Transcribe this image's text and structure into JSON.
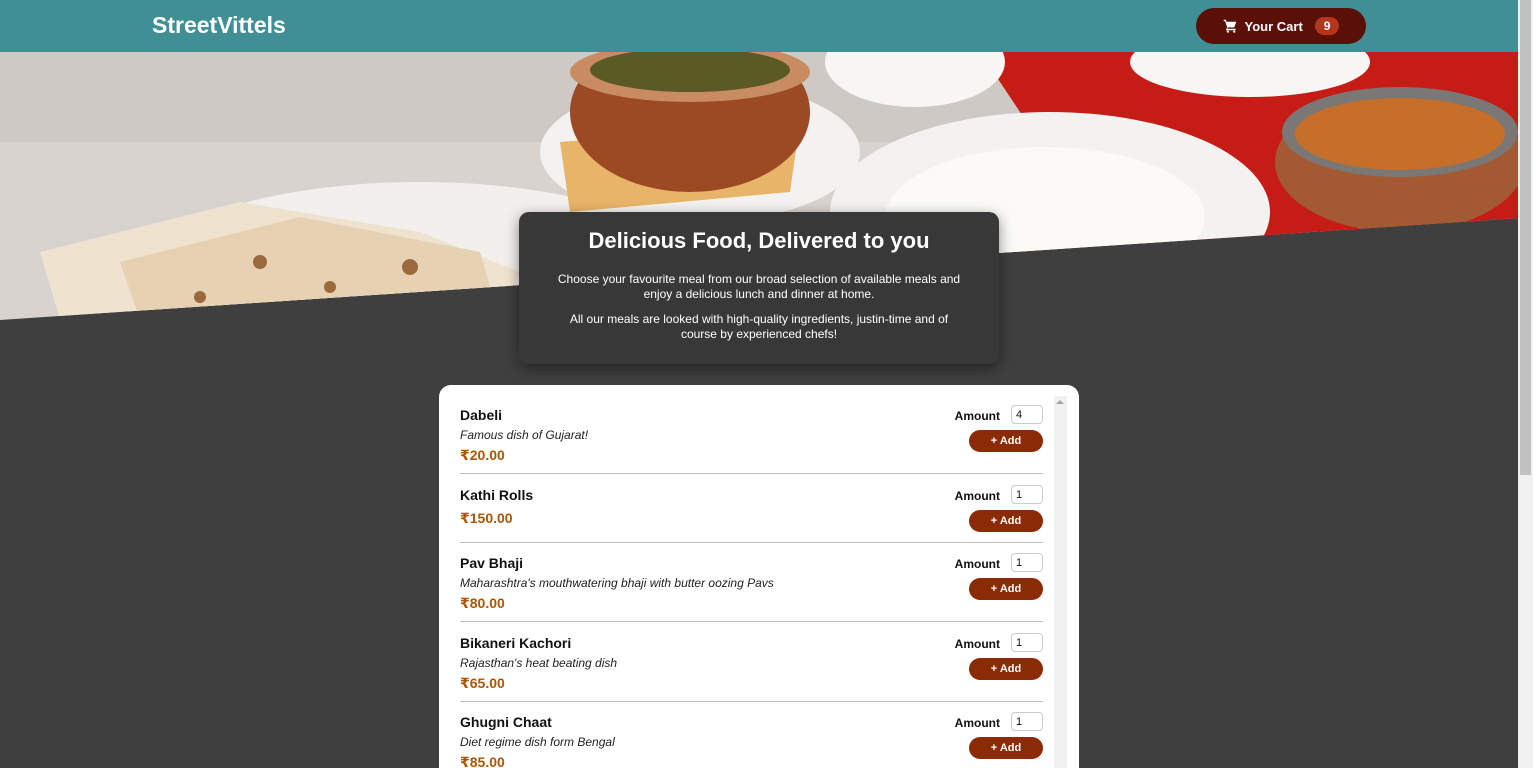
{
  "header": {
    "brand": "StreetVittels",
    "cart": {
      "label": "Your Cart",
      "count": "9",
      "icon": "cart-icon"
    }
  },
  "summary": {
    "title": "Delicious Food, Delivered to you",
    "p1": "Choose your favourite meal from our broad selection of available meals and enjoy a delicious lunch and dinner at home.",
    "p2": "All our meals are looked with high-quality ingredients, justin-time and of course by experienced chefs!"
  },
  "meals": {
    "amount_label": "Amount",
    "add_label": "+ Add",
    "items": [
      {
        "name": "Dabeli",
        "description": "Famous dish of Gujarat!",
        "price": "₹20.00",
        "amount": "4"
      },
      {
        "name": "Kathi Rolls",
        "description": "",
        "price": "₹150.00",
        "amount": "1"
      },
      {
        "name": "Pav Bhaji",
        "description": "Maharashtra's mouthwatering bhaji with butter oozing Pavs",
        "price": "₹80.00",
        "amount": "1"
      },
      {
        "name": "Bikaneri Kachori",
        "description": "Rajasthan's heat beating dish",
        "price": "₹65.00",
        "amount": "1"
      },
      {
        "name": "Ghugni Chaat",
        "description": "Diet regime dish form Bengal",
        "price": "₹85.00",
        "amount": "1"
      }
    ]
  },
  "colors": {
    "header": "#3f8f95",
    "cart_button": "#5a0f07",
    "cart_badge": "#b5361f",
    "page_bg": "#3f3f3f",
    "price": "#ad5502",
    "add_button": "#8a2b06"
  }
}
